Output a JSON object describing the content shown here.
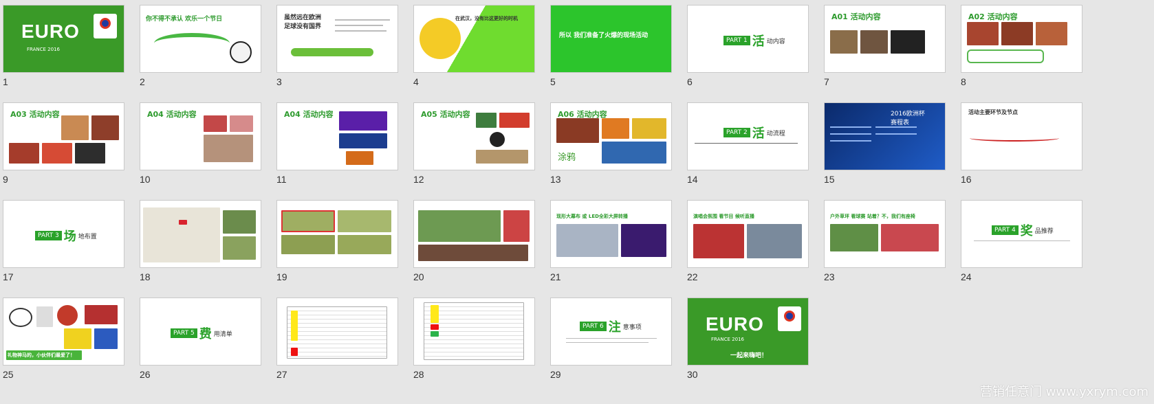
{
  "slides": [
    {
      "num": "1"
    },
    {
      "num": "2"
    },
    {
      "num": "3"
    },
    {
      "num": "4"
    },
    {
      "num": "5"
    },
    {
      "num": "6"
    },
    {
      "num": "7"
    },
    {
      "num": "8"
    },
    {
      "num": "9"
    },
    {
      "num": "10"
    },
    {
      "num": "11"
    },
    {
      "num": "12"
    },
    {
      "num": "13"
    },
    {
      "num": "14"
    },
    {
      "num": "15"
    },
    {
      "num": "16"
    },
    {
      "num": "17"
    },
    {
      "num": "18"
    },
    {
      "num": "19"
    },
    {
      "num": "20"
    },
    {
      "num": "21"
    },
    {
      "num": "22"
    },
    {
      "num": "23"
    },
    {
      "num": "24"
    },
    {
      "num": "25"
    },
    {
      "num": "26"
    },
    {
      "num": "27"
    },
    {
      "num": "28"
    },
    {
      "num": "29"
    },
    {
      "num": "30"
    }
  ],
  "text": {
    "euro": "EURO",
    "euro_sub": "FRANCE 2016",
    "s2": "你不得不承认   欢乐一个节日",
    "s3": "虽然远在欧洲\n足球没有国界",
    "s4": "在武汉，没有比这更好的时机",
    "s5": "所以   我们准备了火爆的现场活动",
    "s6_box": "PART 1",
    "s6_big": "活",
    "s6_rest": "动内容",
    "s7": "A01 活动内容",
    "s8": "A02 活动内容",
    "s9": "A03 活动内容",
    "s10": "A04 活动内容",
    "s11": "A04 活动内容",
    "s12": "A05 活动内容",
    "s13": "A06 活动内容",
    "s13_foot": "涂鸦",
    "s14_box": "PART 2",
    "s14_big": "活",
    "s14_rest": "动流程",
    "s15": "2016欧洲杯\n赛程表",
    "s16": "活动主要环节及节点",
    "s17_box": "PART 3",
    "s17_big": "场",
    "s17_rest": "地布置",
    "s21": "现形大幕布 或 LED全彩大屏转播",
    "s22": "演唱会氛围 看节目 候听直播",
    "s23": "户外草坪 看球赛 站着？不，我们有座椅",
    "s24_box": "PART 4",
    "s24_big": "奖",
    "s24_rest": "品推荐",
    "s25": "礼物神马的，小伙伴们最爱了！",
    "s26_box": "PART 5",
    "s26_big": "费",
    "s26_rest": "用清单",
    "s29_box": "PART 6",
    "s29_big": "注",
    "s29_rest": "意事项",
    "s30_bottom": "一起来嗨吧！"
  },
  "watermark": "营销任意门  www.yxrym.com"
}
